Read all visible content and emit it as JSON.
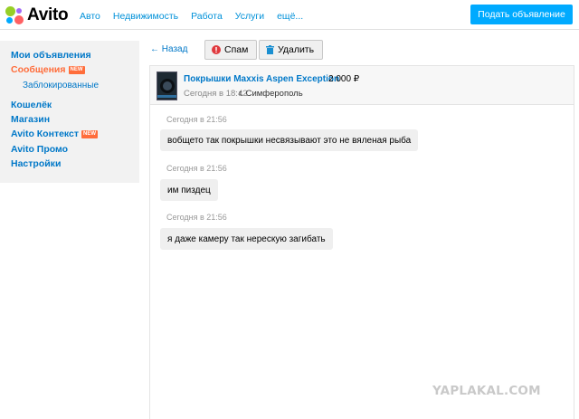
{
  "header": {
    "logo_text": "Avito",
    "nav": [
      "Авто",
      "Недвижимость",
      "Работа",
      "Услуги",
      "ещё..."
    ],
    "post_button": "Подать объявление"
  },
  "sidebar": {
    "items": [
      {
        "label": "Мои объявления"
      },
      {
        "label": "Сообщения",
        "badge": "NEW"
      },
      {
        "label": "Заблокированные"
      },
      {
        "label": "Кошелёк"
      },
      {
        "label": "Магазин"
      },
      {
        "label": "Avito Контекст",
        "badge": "NEW"
      },
      {
        "label": "Avito Промо"
      },
      {
        "label": "Настройки"
      }
    ]
  },
  "toolbar": {
    "back": "← Назад",
    "spam": "Спам",
    "delete": "Удалить"
  },
  "ad": {
    "title": "Покрышки Maxxis Aspen Exception",
    "price": "2 000 ₽",
    "date": "Сегодня в 18:42",
    "city": "г. Симферополь"
  },
  "messages": [
    {
      "time": "Сегодня в 21:56",
      "text": "вобщето так покрышки несвязывают это не вяленая рыба"
    },
    {
      "time": "Сегодня в 21:56",
      "text": "им пиздец"
    },
    {
      "time": "Сегодня в 21:56",
      "text": "я даже камеру так нерескую загибать"
    }
  ],
  "watermark": "YAPLAKAL.COM",
  "colors": {
    "accent": "#00aaff",
    "link": "#0078c8",
    "active": "#ff6d3b",
    "logo_dots": [
      "#97cf26",
      "#a169f7",
      "#00aaff",
      "#ff6163"
    ]
  }
}
